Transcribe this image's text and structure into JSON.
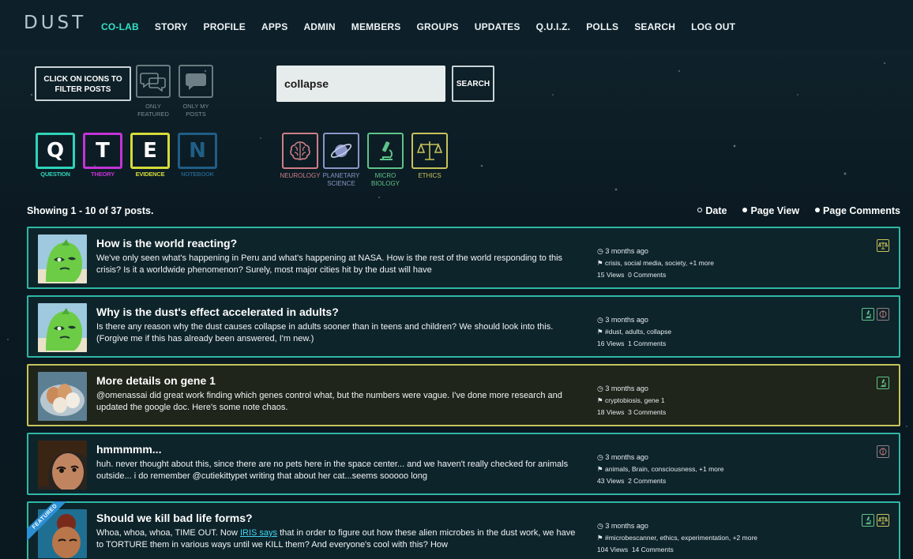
{
  "app": {
    "logo": "DUST",
    "nav": [
      {
        "label": "CO-LAB",
        "active": true
      },
      {
        "label": "STORY"
      },
      {
        "label": "PROFILE"
      },
      {
        "label": "APPS"
      },
      {
        "label": "ADMIN"
      },
      {
        "label": "MEMBERS"
      },
      {
        "label": "GROUPS"
      },
      {
        "label": "UPDATES"
      },
      {
        "label": "Q.U.I.Z."
      },
      {
        "label": "POLLS"
      },
      {
        "label": "SEARCH"
      },
      {
        "label": "LOG OUT"
      }
    ]
  },
  "filters": {
    "hint": "CLICK ON ICONS TO FILTER POSTS",
    "only_featured": "ONLY FEATURED",
    "only_my_posts": "ONLY MY POSTS",
    "types": [
      {
        "letter": "Q",
        "label": "QUESTION",
        "color": "#2fd3b8"
      },
      {
        "letter": "T",
        "label": "THEORY",
        "color": "#c333d6"
      },
      {
        "letter": "E",
        "label": "EVIDENCE",
        "color": "#d4dc3a"
      },
      {
        "letter": "N",
        "label": "NOTEBOOK",
        "color": "#1f5e86"
      }
    ],
    "categories": [
      {
        "label": "NEUROLOGY",
        "icon": "brain-icon",
        "color": "#cf7f86"
      },
      {
        "label": "PLANETARY SCIENCE",
        "icon": "planet-icon",
        "color": "#8b96c8"
      },
      {
        "label": "MICRO BIOLOGY",
        "icon": "microscope-icon",
        "color": "#5ec48a"
      },
      {
        "label": "ETHICS",
        "icon": "scales-icon",
        "color": "#c8c25a"
      }
    ]
  },
  "search": {
    "value": "collapse",
    "button": "SEARCH"
  },
  "listing": {
    "showing": "Showing 1 - 10 of 37 posts.",
    "sorts": [
      {
        "label": "Date",
        "selected": false
      },
      {
        "label": "Page View",
        "selected": true
      },
      {
        "label": "Page Comments",
        "selected": true
      }
    ]
  },
  "posts": [
    {
      "title": "How is the world reacting?",
      "body": "We've only seen what's happening in Peru and what's happening at NASA. How is the rest of the world responding to this crisis? Is it a worldwide phenomenon? Surely, most major cities hit by the dust will have",
      "time": "3 months ago",
      "tags": "crisis, social media, society, +1 more",
      "views": "15 Views",
      "comments": "0 Comments",
      "icons": [
        "scales-icon"
      ],
      "border": "#2fb7a6"
    },
    {
      "title": "Why is the dust's effect accelerated in adults?",
      "body": "Is there any reason why the dust causes collapse in adults sooner than in teens and children? We should look into this. (Forgive me if this has already been answered, I'm new.)",
      "time": "3 months ago",
      "tags": "#dust, adults, collapse",
      "views": "16 Views",
      "comments": "1 Comments",
      "icons": [
        "microscope-icon",
        "brain-icon"
      ],
      "border": "#2fb7a6"
    },
    {
      "title": "More details on gene 1",
      "body": "@omenassai did great work finding which genes control what, but the numbers were vague. I've done more research and updated the google doc. Here's some note chaos.",
      "time": "3 months ago",
      "tags": "cryptobiosis, gene 1",
      "views": "18 Views",
      "comments": "3 Comments",
      "icons": [
        "microscope-icon"
      ],
      "border": "#c6c45b"
    },
    {
      "title": "hmmmmm...",
      "body": "huh. never thought about this, since there are no pets here in the space center... and we haven't really checked for animals outside... i do remember @cutiekittypet writing that about her cat...seems sooooo long",
      "time": "3 months ago",
      "tags": "animals, Brain, consciousness, +1 more",
      "views": "43 Views",
      "comments": "2 Comments",
      "icons": [
        "brain-icon"
      ],
      "border": "#2fb7a6"
    },
    {
      "title": "Should we kill bad life forms?",
      "body_pre": "Whoa, whoa, whoa, TIME OUT. Now ",
      "body_link": "IRIS says",
      "body_post": " that in order to figure out how these alien microbes in the dust work, we have to TORTURE them in various ways until we KILL them?  And everyone's cool with this?  How",
      "featured": "FEATURED",
      "time": "3 months ago",
      "tags": "#microbescanner, ethics, experimentation, +2 more",
      "views": "104 Views",
      "comments": "14 Comments",
      "icons": [
        "microscope-icon",
        "scales-icon"
      ],
      "border": "#2fb7a6"
    }
  ]
}
